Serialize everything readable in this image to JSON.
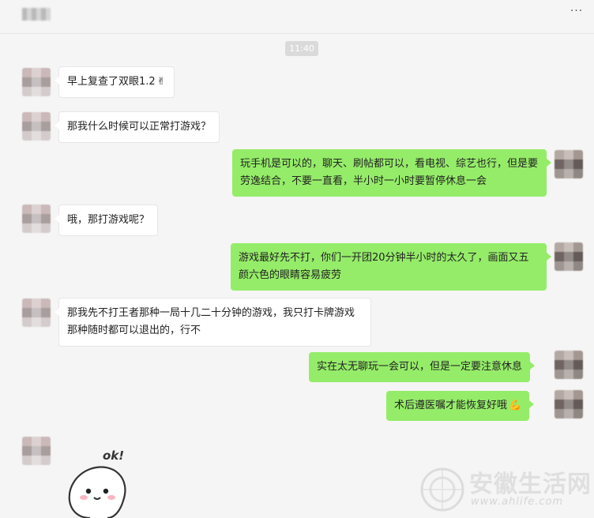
{
  "header": {
    "title": "",
    "more_label": "···"
  },
  "timestamp": "11:40",
  "messages": [
    {
      "side": "in",
      "text": "早上复查了双眼1.2",
      "emoji": "✌"
    },
    {
      "side": "in",
      "text": "那我什么时候可以正常打游戏？"
    },
    {
      "side": "out",
      "text": "玩手机是可以的，聊天、刷帖都可以，看电视、综艺也行，但是要劳逸结合，不要一直看，半小时一小时要暂停休息一会"
    },
    {
      "side": "in",
      "text": "哦，那打游戏呢？"
    },
    {
      "side": "out",
      "text": "游戏最好先不打，你们一开团20分钟半小时的太久了，画面又五颜六色的眼睛容易疲劳"
    },
    {
      "side": "in",
      "text": "那我先不打王者那种一局十几二十分钟的游戏，我只打卡牌游戏那种随时都可以退出的，行不"
    },
    {
      "side": "out",
      "text": "实在太无聊玩一会可以，但是一定要注意休息"
    },
    {
      "side": "out",
      "text": "术后遵医嘱才能恢复好哦",
      "emoji": "💪"
    }
  ],
  "sticker": {
    "text": "ok!"
  },
  "watermark": {
    "cn": "安徽生活网",
    "en": "www.ahlife.com"
  },
  "colors": {
    "bubble_out": "#95ec69",
    "bubble_in": "#ffffff",
    "background": "#f5f5f5"
  }
}
